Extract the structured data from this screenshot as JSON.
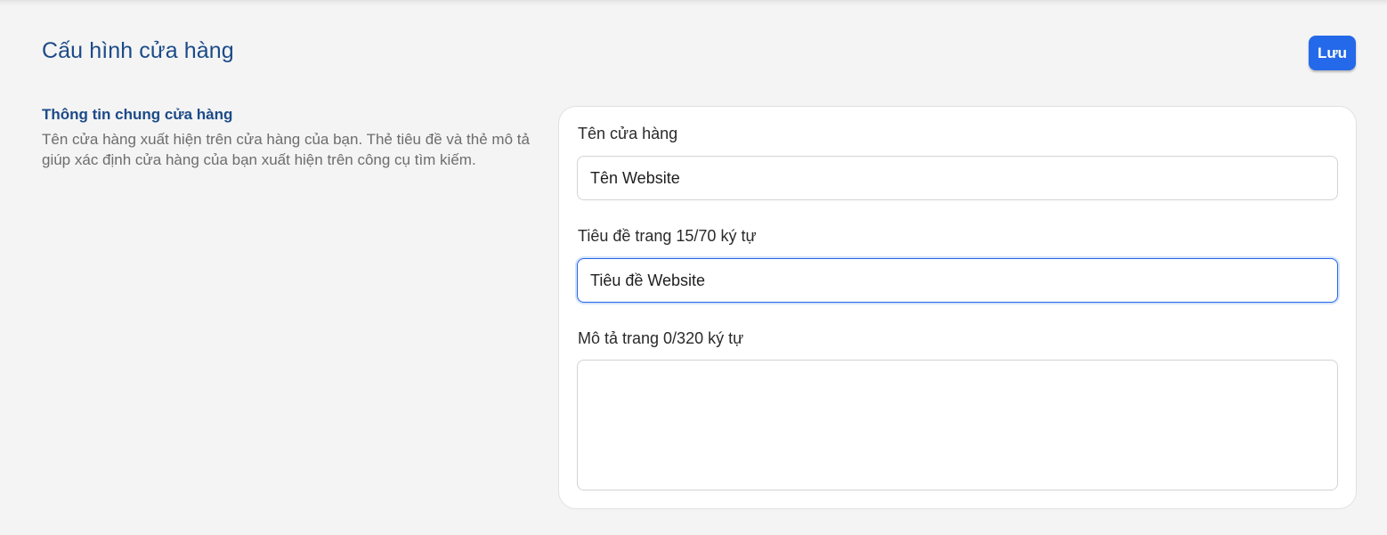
{
  "header": {
    "title": "Cấu hình cửa hàng",
    "save_label": "Lưu"
  },
  "section": {
    "title": "Thông tin chung cửa hàng",
    "description": "Tên cửa hàng xuất hiện trên cửa hàng của bạn. Thẻ tiêu đề và thẻ mô tả giúp xác định cửa hàng của bạn xuất hiện trên công cụ tìm kiếm."
  },
  "form": {
    "store_name": {
      "label": "Tên cửa hàng",
      "value": "Tên Website"
    },
    "page_title": {
      "label": "Tiêu đề trang 15/70 ký tự",
      "value": "Tiêu đề Website"
    },
    "page_description": {
      "label": "Mô tả trang 0/320 ký tự",
      "value": ""
    }
  },
  "colors": {
    "accent": "#2469e9",
    "heading": "#1c4a88",
    "background": "#f4f4f4"
  }
}
